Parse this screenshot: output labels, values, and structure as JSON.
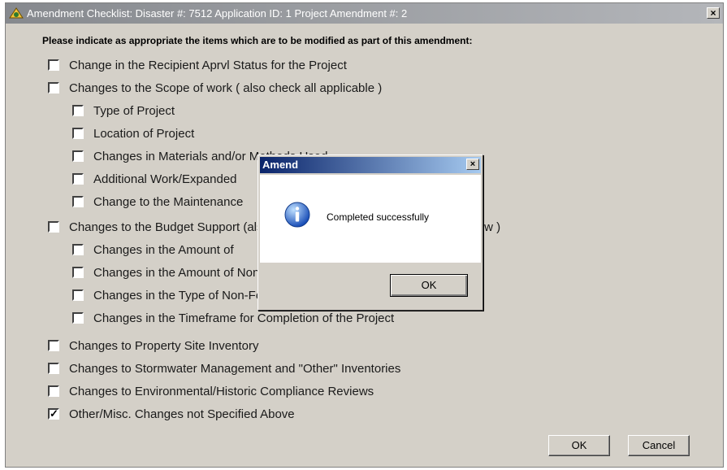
{
  "window": {
    "title": "Amendment Checklist: Disaster #: 7512  Application ID: 1  Project Amendment #: 2",
    "close_label": "×",
    "app_icon": "app-icon"
  },
  "instruction": "Please indicate as appropriate the items which are to be modified as part of this amendment:",
  "checklist": [
    {
      "label": "Change in the Recipient Aprvl Status for the Project",
      "checked": false
    },
    {
      "label": "Changes to the Scope of work ( also check all applicable )",
      "checked": false
    },
    {
      "label": "Type of Project",
      "checked": false
    },
    {
      "label": "Location of Project",
      "checked": false
    },
    {
      "label": "Changes in Materials and/or Methods Used",
      "checked": false
    },
    {
      "label": "Additional Work/Expanded",
      "checked": false
    },
    {
      "label": "Change to the Maintenance",
      "checked": false
    },
    {
      "label": "Changes to the Budget Support (also check all applicable subcategories below )",
      "checked": false
    },
    {
      "label": "Changes in the Amount of",
      "checked": false
    },
    {
      "label": "Changes in the Amount of Non-Federal Funding for the Project",
      "checked": false
    },
    {
      "label": "Changes in the Type of Non-Federal Funding",
      "checked": false
    },
    {
      "label": "Changes in the Timeframe for Completion of the Project",
      "checked": false
    },
    {
      "label": "Changes to Property Site Inventory",
      "checked": false
    },
    {
      "label": "Changes to Stormwater Management and \"Other\" Inventories",
      "checked": false
    },
    {
      "label": "Changes to Environmental/Historic Compliance Reviews",
      "checked": false
    },
    {
      "label": "Other/Misc. Changes not Specified Above",
      "checked": true
    }
  ],
  "check_mark": "✓",
  "buttons": {
    "ok": "OK",
    "cancel": "Cancel"
  },
  "dialog": {
    "title": "Amend",
    "close_label": "×",
    "icon": "info-icon",
    "message": "Completed successfully",
    "ok": "OK"
  }
}
